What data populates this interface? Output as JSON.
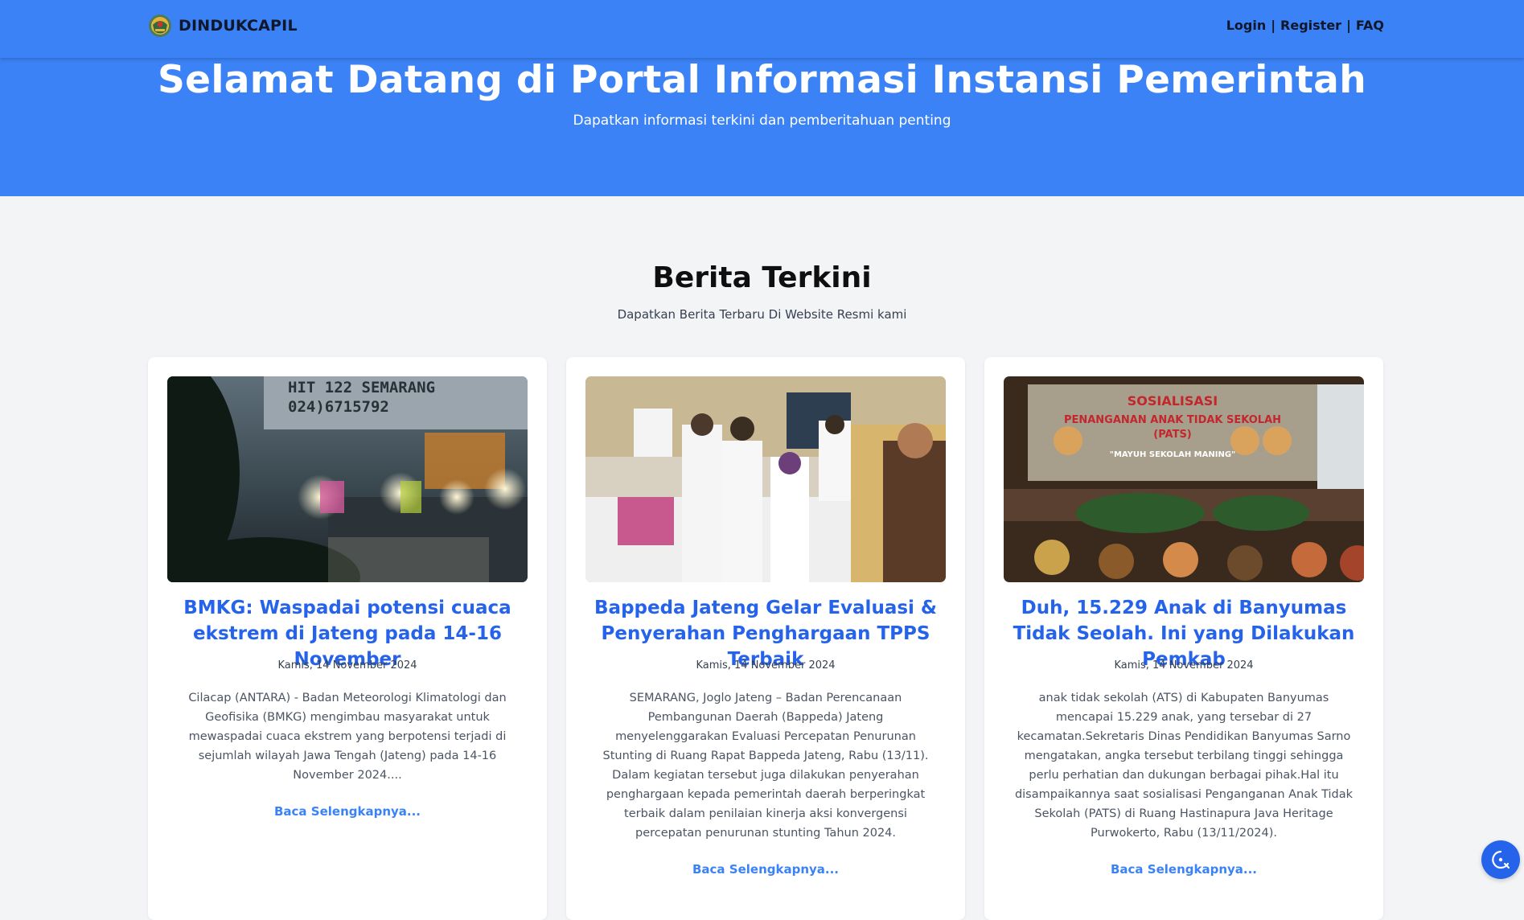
{
  "navbar": {
    "brand_name": "DINDUKCAPIL",
    "links": [
      {
        "label": "Login"
      },
      {
        "label": "Register"
      },
      {
        "label": "FAQ"
      }
    ],
    "separator": "|"
  },
  "hero": {
    "title": "Selamat Datang di Portal Informasi Instansi Pemerintah",
    "subtitle": "Dapatkan informasi terkini dan pemberitahuan penting"
  },
  "news": {
    "title": "Berita Terkini",
    "subtitle": "Dapatkan Berita Terbaru Di Website Resmi kami",
    "cards": [
      {
        "title": "BMKG: Waspadai potensi cuaca ekstrem di Jateng pada 14-16 November",
        "date": "Kamis, 14 November 2024",
        "excerpt": "Cilacap (ANTARA) - Badan Meteorologi Klimatologi dan Geofisika (BMKG) mengimbau masyarakat untuk mewaspadai cuaca ekstrem yang berpotensi terjadi di sejumlah wilayah Jawa Tengah (Jateng) pada 14-16 November 2024....",
        "read_more": "Baca Selengkapnya...",
        "image_text": [
          "HIT 122 SEMARANG",
          "024)6715792"
        ]
      },
      {
        "title": "Bappeda Jateng Gelar Evaluasi & Penyerahan Penghargaan TPPS Terbaik",
        "date": "Kamis, 14 November 2024",
        "excerpt": "SEMARANG, Joglo Jateng – Badan Perencanaan Pembangunan Daerah (Bappeda) Jateng menyelenggarakan Evaluasi Percepatan Penurunan Stunting di Ruang Rapat Bappeda Jateng, Rabu (13/11). Dalam kegiatan tersebut juga dilakukan penyerahan penghargaan kepada pemerintah daerah berperingkat terbaik dalam penilaian kinerja aksi konvergensi percepatan penurunan stunting Tahun 2024.",
        "read_more": "Baca Selengkapnya..."
      },
      {
        "title": "Duh, 15.229 Anak di Banyumas Tidak Seolah. Ini yang Dilakukan Pemkab",
        "date": "Kamis, 14 November 2024",
        "excerpt": "anak tidak sekolah (ATS) di Kabupaten Banyumas mencapai 15.229 anak, yang tersebar di 27 kecamatan.Sekretaris Dinas Pendidikan Banyumas Sarno mengatakan, angka tersebut terbilang tinggi sehingga perlu perhatian dan dukungan berbagai pihak.Hal itu disampaikannya saat sosialisasi Penganganan Anak Tidak Sekolah (PATS) di Ruang Hastinapura Java Heritage Purwokerto, Rabu (13/11/2024).",
        "read_more": "Baca Selengkapnya...",
        "image_text": [
          "SOSIALISASI",
          "PENANGANAN ANAK TIDAK SEKOLAH",
          "(PATS)",
          "\"MAYUH SEKOLAH MANING\""
        ]
      }
    ]
  },
  "icons": {
    "brand": "coat-of-arms-icon",
    "fab": "chat-support-icon"
  },
  "colors": {
    "primary": "#3b82f6",
    "link": "#2563eb",
    "background": "#f3f4f6"
  }
}
